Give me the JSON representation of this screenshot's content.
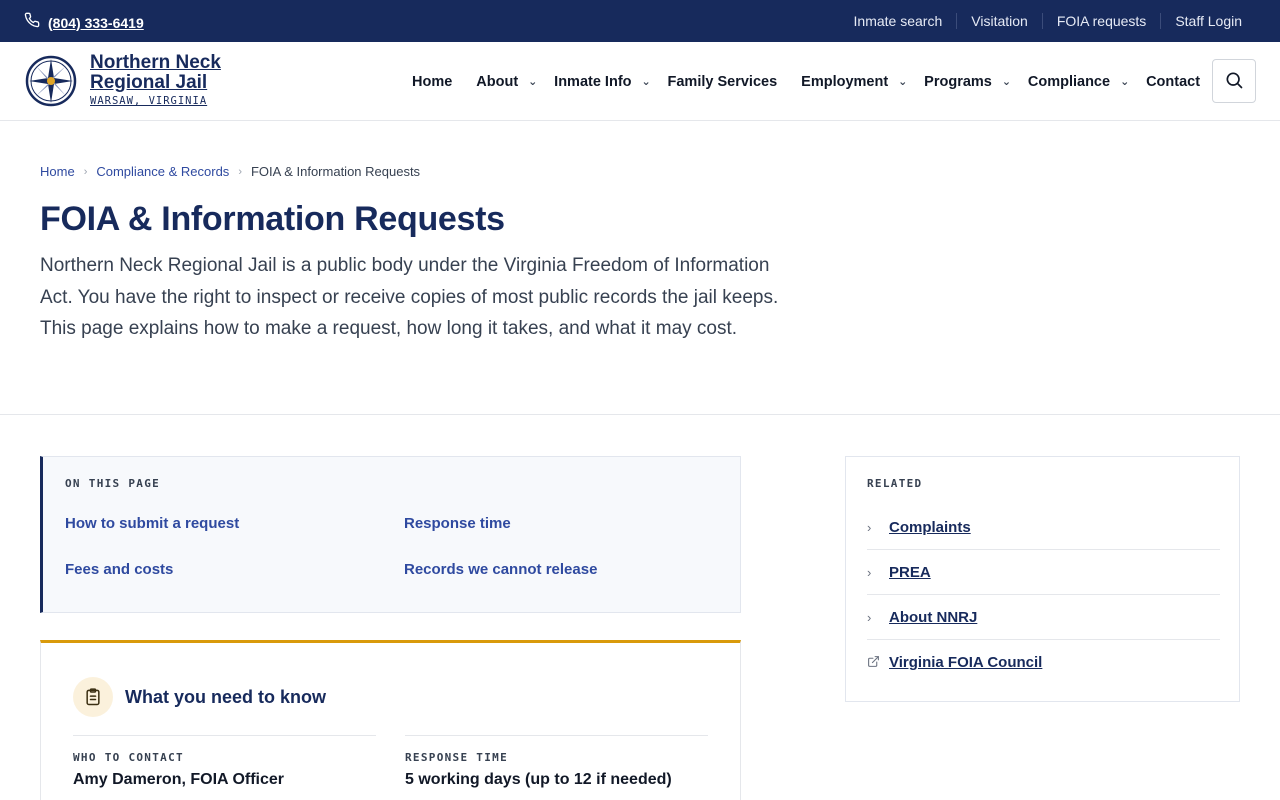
{
  "utility": {
    "phone": "(804) 333-6419",
    "links": [
      "Inmate search",
      "Visitation",
      "FOIA requests",
      "Staff Login"
    ]
  },
  "brand": {
    "name_line1": "Northern Neck",
    "name_line2": "Regional Jail",
    "location": "WARSAW, VIRGINIA",
    "logo_icon": "compass-seal-icon"
  },
  "nav": {
    "items": [
      {
        "label": "Home",
        "has_menu": false
      },
      {
        "label": "About",
        "has_menu": true
      },
      {
        "label": "Inmate Info",
        "has_menu": true
      },
      {
        "label": "Family Services",
        "has_menu": false
      },
      {
        "label": "Employment",
        "has_menu": true
      },
      {
        "label": "Programs",
        "has_menu": true
      },
      {
        "label": "Compliance",
        "has_menu": true
      },
      {
        "label": "Contact",
        "has_menu": false
      }
    ],
    "search_icon": "search-icon"
  },
  "breadcrumb": [
    "Home",
    "Compliance & Records",
    "FOIA & Information Requests"
  ],
  "page": {
    "title": "FOIA & Information Requests",
    "intro": "Northern Neck Regional Jail is a public body under the Virginia Freedom of Information Act. You have the right to inspect or receive copies of most public records the jail keeps. This page explains how to make a request, how long it takes, and what it may cost."
  },
  "toc": {
    "title": "ON THIS PAGE",
    "links": [
      "How to submit a request",
      "Response time",
      "Fees and costs",
      "Records we cannot release"
    ]
  },
  "card": {
    "title": "What you need to know",
    "icon": "clipboard-icon",
    "items": [
      {
        "label": "WHO TO CONTACT",
        "value": "Amy Dameron, FOIA Officer"
      },
      {
        "label": "RESPONSE TIME",
        "value": "5 working days (up to 12 if needed)"
      }
    ]
  },
  "related": {
    "title": "RELATED",
    "items": [
      {
        "label": "Complaints",
        "icon": "chevron-right-icon"
      },
      {
        "label": "PREA",
        "icon": "chevron-right-icon"
      },
      {
        "label": "About NNRJ",
        "icon": "chevron-right-icon"
      },
      {
        "label": "Virginia FOIA Council",
        "icon": "external-link-icon"
      }
    ]
  },
  "colors": {
    "navy": "#172a5c",
    "link": "#2f4aa0",
    "accent_gold": "#d99a0b"
  }
}
